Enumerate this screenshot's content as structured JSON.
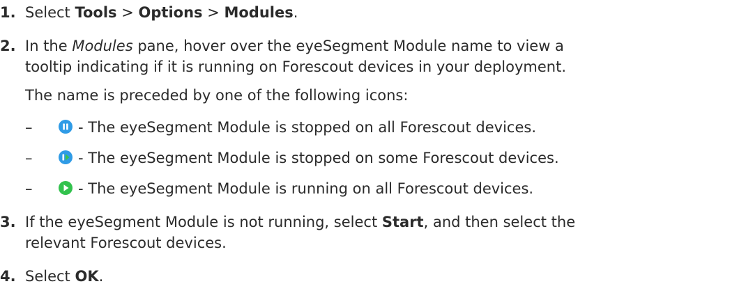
{
  "steps": [
    {
      "number": "1.",
      "prefix": "Select ",
      "menu1": "Tools",
      "sep1": " > ",
      "menu2": "Options",
      "sep2": " > ",
      "menu3": "Modules",
      "suffix": "."
    },
    {
      "number": "2.",
      "line1_prefix": "In the ",
      "pane_name": "Modules",
      "line1_suffix": " pane, hover over the eyeSegment Module name to view a",
      "line2": "tooltip indicating if it is running on Forescout devices in your deployment.",
      "intro": "The name is preceded by one of the following icons:",
      "bullets": [
        {
          "dash": "–",
          "icon": "stopped-all-icon",
          "text": "- The eyeSegment Module is stopped on all Forescout devices."
        },
        {
          "dash": "–",
          "icon": "stopped-some-icon",
          "text": "- The eyeSegment Module is stopped on some Forescout devices."
        },
        {
          "dash": "–",
          "icon": "running-all-icon",
          "text": "- The eyeSegment Module is running on all Forescout devices."
        }
      ]
    },
    {
      "number": "3.",
      "line1_prefix": "If the eyeSegment Module is not running, select ",
      "button": "Start",
      "line1_suffix": ", and then select the",
      "line2": "relevant Forescout devices."
    },
    {
      "number": "4.",
      "prefix": "Select ",
      "button": "OK",
      "suffix": "."
    }
  ],
  "colors": {
    "text": "#2b2b2b",
    "icon_blue": "#2f9be6",
    "icon_green": "#32c24d"
  }
}
